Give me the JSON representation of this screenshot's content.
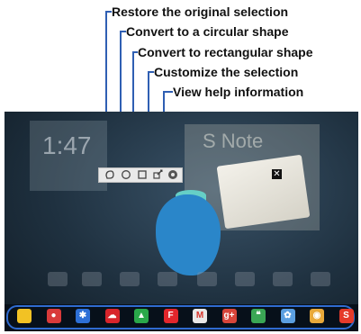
{
  "callouts": [
    {
      "label": "Restore the original selection"
    },
    {
      "label": "Convert to a circular shape"
    },
    {
      "label": "Convert to rectangular shape"
    },
    {
      "label": "Customize the selection"
    },
    {
      "label": "View help information"
    }
  ],
  "widgets": {
    "clock_time": "1:47",
    "snote_title": "S Note"
  },
  "toolbar": {
    "tools": [
      {
        "icon": "restore-icon"
      },
      {
        "icon": "circle-shape-icon"
      },
      {
        "icon": "rectangle-shape-icon"
      },
      {
        "icon": "customize-selection-icon"
      },
      {
        "icon": "help-icon"
      }
    ]
  },
  "colors": {
    "leader_blue": "#2f5fb3",
    "selection_blob": "#2a86c9",
    "dock_outline": "#2f6bd0"
  },
  "dock": {
    "apps": [
      {
        "name": "My Files",
        "icon": "my-files-icon",
        "color": "#f2c224",
        "glyph": ""
      },
      {
        "name": "Dropbox",
        "icon": "record-icon",
        "color": "#d93a3a",
        "glyph": "●"
      },
      {
        "name": "Bluetooth",
        "icon": "bluetooth-icon",
        "color": "#2d6fd6",
        "glyph": "✱"
      },
      {
        "name": "Cloud",
        "icon": "cloud-icon",
        "color": "#d8242b",
        "glyph": "☁"
      },
      {
        "name": "Drive",
        "icon": "drive-icon",
        "color": "#2aa84a",
        "glyph": "▲"
      },
      {
        "name": "Flipboard",
        "icon": "flipboard-icon",
        "color": "#e2262c",
        "glyph": "F"
      },
      {
        "name": "Gmail",
        "icon": "gmail-icon",
        "color": "#e8e8e8",
        "glyph": "M"
      },
      {
        "name": "Google+",
        "icon": "google-plus-icon",
        "color": "#d8453a",
        "glyph": "g+"
      },
      {
        "name": "Hangouts",
        "icon": "hangouts-icon",
        "color": "#3aa655",
        "glyph": "❝"
      },
      {
        "name": "Photos",
        "icon": "photos-icon",
        "color": "#5b9fe0",
        "glyph": "✿"
      },
      {
        "name": "Chrome",
        "icon": "chrome-icon",
        "color": "#e9a93a",
        "glyph": "◉"
      },
      {
        "name": "S",
        "icon": "samsung-app-icon",
        "color": "#e53a2a",
        "glyph": "S"
      }
    ]
  }
}
